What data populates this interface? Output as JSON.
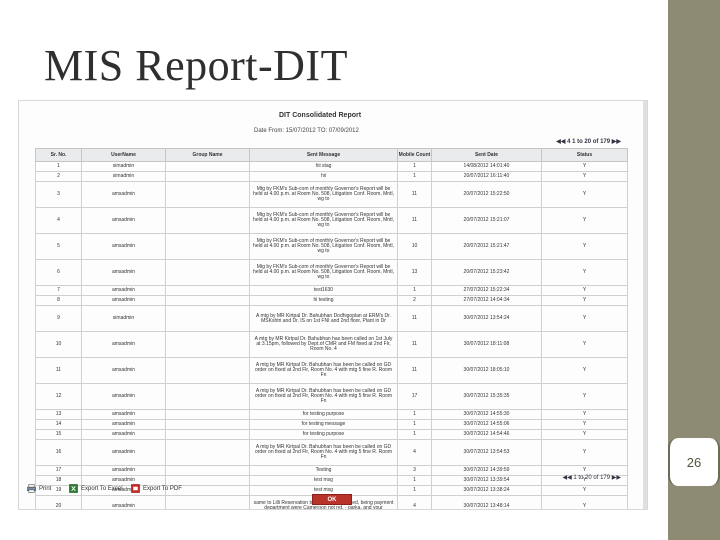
{
  "slide": {
    "title": "MIS Report-DIT",
    "page_number": "26"
  },
  "report": {
    "title": "DIT Consolidated Report",
    "date_range": "Date From: 15/07/2012 TO: 07/09/2012",
    "pager_top": "4 1 to 20 of 179",
    "pager_bottom": "1 to 20 of 179",
    "columns": [
      "Sr. No.",
      "UserName",
      "Group Name",
      "Sent Message",
      "Mobile Count",
      "Sent Date",
      "Status"
    ],
    "rows": [
      {
        "sr": "1",
        "user": "simadmin",
        "group": "",
        "msg": "hii stag",
        "count": "1",
        "date": "14/08/2012 14:01:40",
        "status": "Y",
        "size": "short"
      },
      {
        "sr": "2",
        "user": "simadmin",
        "group": "",
        "msg": "hii",
        "count": "1",
        "date": "20/07/2012 16:11:40",
        "status": "Y",
        "size": "short"
      },
      {
        "sr": "3",
        "user": "amsadmin",
        "group": "",
        "msg": "Mtg by FKM's Sub-com of monthly Governor's Report will be held at 4.00 p.m. at Room No. 508, Litigation Conf. Room, Mntl, wg to",
        "count": "11",
        "date": "20/07/2012 15:22:50",
        "status": "Y",
        "size": "xtall"
      },
      {
        "sr": "4",
        "user": "amsadmin",
        "group": "",
        "msg": "Mtg by FKM's Sub-com of monthly Governor's Report will be held at 4.00 p.m. at Room No. 508, Litigation Conf. Room, Mntl, wg to",
        "count": "11",
        "date": "20/07/2012 15:21:07",
        "status": "Y",
        "size": "xtall"
      },
      {
        "sr": "5",
        "user": "amsadmin",
        "group": "",
        "msg": "Mtg by FKM's Sub-com of monthly Governor's Report will be held at 4.00 p.m. at Room No. 508, Litigation Conf. Room, Mntl, wg to",
        "count": "10",
        "date": "20/07/2012 15:21:47",
        "status": "Y",
        "size": "xtall"
      },
      {
        "sr": "6",
        "user": "amsadmin",
        "group": "",
        "msg": "Mtg by FKM's Sub-com of monthly Governor's Report will be held at 4.00 p.m. at Room No. 508, Litigation Conf. Room, Mntl, wg to",
        "count": "13",
        "date": "20/07/2012 15:23:42",
        "status": "Y",
        "size": "xtall"
      },
      {
        "sr": "7",
        "user": "amsadmin",
        "group": "",
        "msg": "test1630",
        "count": "1",
        "date": "27/07/2012 15:22:34",
        "status": "Y",
        "size": "short"
      },
      {
        "sr": "8",
        "user": "amsadmin",
        "group": "",
        "msg": "hi testing",
        "count": "2",
        "date": "27/07/2012 14:04:34",
        "status": "Y",
        "size": "short"
      },
      {
        "sr": "9",
        "user": "simadmin",
        "group": "",
        "msg": "A mtg by MR Kirtpal Dr. Bahubhan Dodhigoplan at ERM's Dr. MSKshtri and Dr. IS on 1st FNI and 2nd floor, Plant in Dr",
        "count": "11",
        "date": "30/07/2012 13:54:24",
        "status": "Y",
        "size": "xtall"
      },
      {
        "sr": "10",
        "user": "amsadmin",
        "group": "",
        "msg": "A mtg by MR Kirtpal Dr. Bahubhan has been called on 1st July at 3.15pm, followed by Dept.of CMR and FM fixed at 2nd Flr, Room No. 4",
        "count": "11",
        "date": "30/07/2012 18:11:08",
        "status": "Y",
        "size": "xtall"
      },
      {
        "sr": "11",
        "user": "amsadmin",
        "group": "",
        "msg": "A mtg by MR Kirtpal Dr. Bahubhan has been be called on GD order on fixed at 2nd Flr, Room No. 4 with mtg 5 fine R. Room Fn",
        "count": "11",
        "date": "30/07/2012 18:05:10",
        "status": "Y",
        "size": "xtall"
      },
      {
        "sr": "12",
        "user": "amsadmin",
        "group": "",
        "msg": "A mtg by MR Kirtpal Dr. Bahubhan has been be called on GD order on fixed at 2nd Flr, Room No. 4 with mtg 5 fine R. Room Fn",
        "count": "17",
        "date": "30/07/2012 15:35:35",
        "status": "Y",
        "size": "xtall"
      },
      {
        "sr": "13",
        "user": "amsadmin",
        "group": "",
        "msg": "for testing purpose",
        "count": "1",
        "date": "30/07/2012 14:55:30",
        "status": "Y",
        "size": "short"
      },
      {
        "sr": "14",
        "user": "amsadmin",
        "group": "",
        "msg": "for testing message",
        "count": "1",
        "date": "30/07/2012 14:55:06",
        "status": "Y",
        "size": "short"
      },
      {
        "sr": "15",
        "user": "amsadmin",
        "group": "",
        "msg": "for testing purpose",
        "count": "1",
        "date": "30/07/2012 14:54:46",
        "status": "Y",
        "size": "short"
      },
      {
        "sr": "16",
        "user": "amsadmin",
        "group": "",
        "msg": "A mtg by MR Kirtpal Dr. Bahubhan has been be called on GD order on fixed at 2nd Flr, Room No. 4 with mtg 5 fine R. Room Fn",
        "count": "4",
        "date": "30/07/2012 13:54:53",
        "status": "Y",
        "size": "xtall"
      },
      {
        "sr": "17",
        "user": "amsadmin",
        "group": "",
        "msg": "Testing",
        "count": "3",
        "date": "30/07/2012 14:39:59",
        "status": "Y",
        "size": "short"
      },
      {
        "sr": "18",
        "user": "amsadmin",
        "group": "",
        "msg": "test msg",
        "count": "1",
        "date": "30/07/2012 13:39:54",
        "status": "Y",
        "size": "short"
      },
      {
        "sr": "19",
        "user": "amsadmin",
        "group": "",
        "msg": "test msg",
        "count": "1",
        "date": "30/07/2012 13:38:24",
        "status": "Y",
        "size": "short"
      },
      {
        "sr": "20",
        "user": "amsadmin",
        "group": "",
        "msg": "same to Lilli Reservation to elements was used, being payment department were Cameroon not ret. - parka, and your",
        "count": "4",
        "date": "30/07/2012 13:48:14",
        "status": "Y",
        "size": "tall"
      }
    ]
  },
  "toolbar": {
    "print_label": "Print",
    "excel_label": "Export To Excel",
    "pdf_label": "Export To PDF",
    "ok_label": "OK"
  },
  "colors": {
    "accent_bar": "#8e8b75",
    "ok_button": "#b8342a"
  }
}
